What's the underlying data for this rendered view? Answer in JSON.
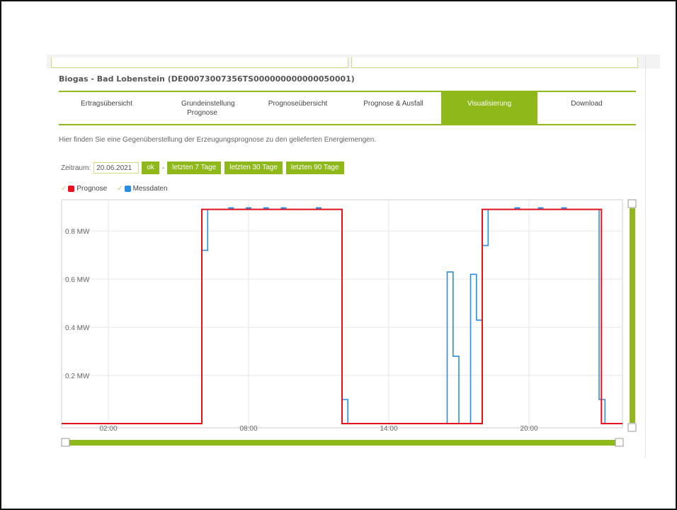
{
  "header": {
    "title": "Biogas - Bad Lobenstein (DE00073007356TS000000000000050001)"
  },
  "tabs": [
    {
      "label": "Ertragsübersicht",
      "active": false
    },
    {
      "label": "Grundeinstellung Prognose",
      "active": false
    },
    {
      "label": "Prognoseübersicht",
      "active": false
    },
    {
      "label": "Prognose & Ausfall",
      "active": false
    },
    {
      "label": "Visualisierung",
      "active": true
    },
    {
      "label": "Download",
      "active": false
    }
  ],
  "intro_text": "Hier finden Sie eine Gegenüberstellung der Erzeugungsprognose zu den gelieferten Energiemengen.",
  "controls": {
    "zeitraum_label": "Zeitraum:",
    "date_value": "20.06.2021",
    "ok_label": "ok",
    "dash": "-",
    "last7_label": "letzten 7 Tage",
    "last30_label": "letzten 30 Tage",
    "last90_label": "letzten 90 Tage"
  },
  "legend": {
    "prognose_label": "Prognose",
    "messdaten_label": "Messdaten"
  },
  "colors": {
    "accent": "#8fb81a",
    "prognose": "#e8101c",
    "messdaten": "#2b8de0"
  },
  "chart_data": {
    "type": "line",
    "step": true,
    "x_unit": "hours",
    "xlim": [
      0,
      24
    ],
    "ylim": [
      0,
      0.93
    ],
    "x_ticks": [
      {
        "value": 2,
        "label": "02:00"
      },
      {
        "value": 8,
        "label": "08:00"
      },
      {
        "value": 14,
        "label": "14:00"
      },
      {
        "value": 20,
        "label": "20:00"
      }
    ],
    "y_ticks": [
      {
        "value": 0.2,
        "label": "0.2 MW"
      },
      {
        "value": 0.4,
        "label": "0.4 MW"
      },
      {
        "value": 0.6,
        "label": "0.6 MW"
      },
      {
        "value": 0.8,
        "label": "0.8 MW"
      }
    ],
    "series": [
      {
        "name": "Prognose",
        "color": "#e8101c",
        "points": [
          [
            0,
            0
          ],
          [
            6,
            0
          ],
          [
            6,
            0.89
          ],
          [
            12,
            0.89
          ],
          [
            12,
            0
          ],
          [
            18,
            0
          ],
          [
            18,
            0.89
          ],
          [
            23.1,
            0.89
          ],
          [
            23.1,
            0
          ],
          [
            24,
            0
          ]
        ]
      },
      {
        "name": "Messdaten",
        "color": "#2b8de0",
        "points": [
          [
            0,
            0
          ],
          [
            6,
            0
          ],
          [
            6,
            0.72
          ],
          [
            6.25,
            0.72
          ],
          [
            6.25,
            0.89
          ],
          [
            12,
            0.89
          ],
          [
            12,
            0.1
          ],
          [
            12.25,
            0.1
          ],
          [
            12.25,
            0
          ],
          [
            16.5,
            0
          ],
          [
            16.5,
            0.63
          ],
          [
            16.75,
            0.63
          ],
          [
            16.75,
            0.28
          ],
          [
            17,
            0.28
          ],
          [
            17,
            0
          ],
          [
            17.5,
            0
          ],
          [
            17.5,
            0.62
          ],
          [
            17.75,
            0.62
          ],
          [
            17.75,
            0.43
          ],
          [
            18,
            0.43
          ],
          [
            18,
            0.74
          ],
          [
            18.25,
            0.74
          ],
          [
            18.25,
            0.89
          ],
          [
            23,
            0.89
          ],
          [
            23,
            0.1
          ],
          [
            23.25,
            0.1
          ],
          [
            23.25,
            0
          ],
          [
            24,
            0
          ]
        ]
      }
    ],
    "markers": {
      "series": "Messdaten",
      "y": 0.89,
      "x": [
        7.25,
        8.0,
        8.75,
        9.5,
        11.0,
        19.5,
        20.5,
        21.5
      ]
    }
  }
}
